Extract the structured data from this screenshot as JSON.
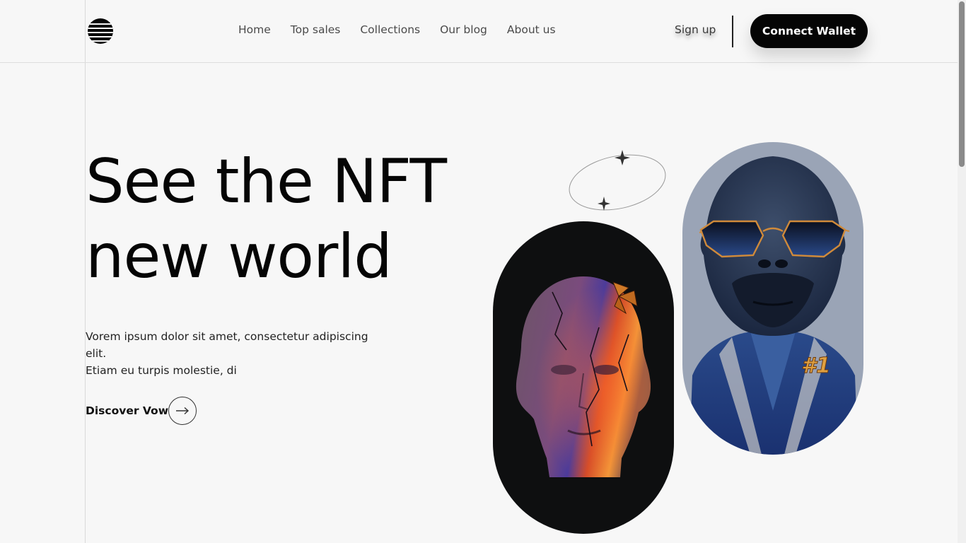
{
  "header": {
    "logo_icon": "striped-globe-icon",
    "nav": [
      "Home",
      "Top sales",
      "Collections",
      "Our blog",
      "About us"
    ],
    "signup_label": "Sign up",
    "connect_label": "Connect Wallet"
  },
  "hero": {
    "title_line1": "See the NFT",
    "title_line2": "new world",
    "description_line1": "Vorem ipsum dolor sit amet, consectetur adipiscing elit.",
    "description_line2": "Etiam eu turpis molestie, di",
    "cta_label": "Discover Vow",
    "cta_icon": "arrow-right-icon"
  },
  "gallery": {
    "badge_text": "#1",
    "head_card_icon": "cracked-head-sculpture-image",
    "gorilla_card_icon": "gorilla-sunglasses-image",
    "decoration_icon": "sparkle-orbit-icon"
  },
  "colors": {
    "background": "#f7f7f7",
    "primary": "#050505",
    "gorilla_bg": "#9aa4b6"
  }
}
